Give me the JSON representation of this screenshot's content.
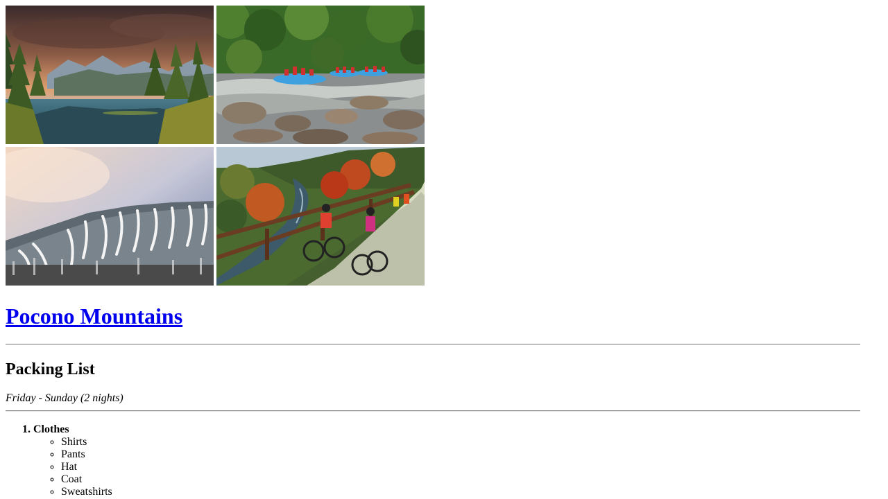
{
  "gallery": {
    "images": [
      {
        "name": "mountain-lake-sunset-photo"
      },
      {
        "name": "river-rafting-photo"
      },
      {
        "name": "ski-slopes-photo"
      },
      {
        "name": "rail-trail-cycling-photo"
      }
    ]
  },
  "header": {
    "title": "Pocono Mountains"
  },
  "packing": {
    "heading": "Packing List",
    "dates": "Friday - Sunday (2 nights)",
    "categories": [
      {
        "label": "Clothes",
        "items": [
          "Shirts",
          "Pants",
          "Hat",
          "Coat",
          "Sweatshirts"
        ]
      }
    ]
  },
  "colors": {
    "link": "#0000ee",
    "text": "#000000",
    "rule": "#8a8a8a"
  }
}
